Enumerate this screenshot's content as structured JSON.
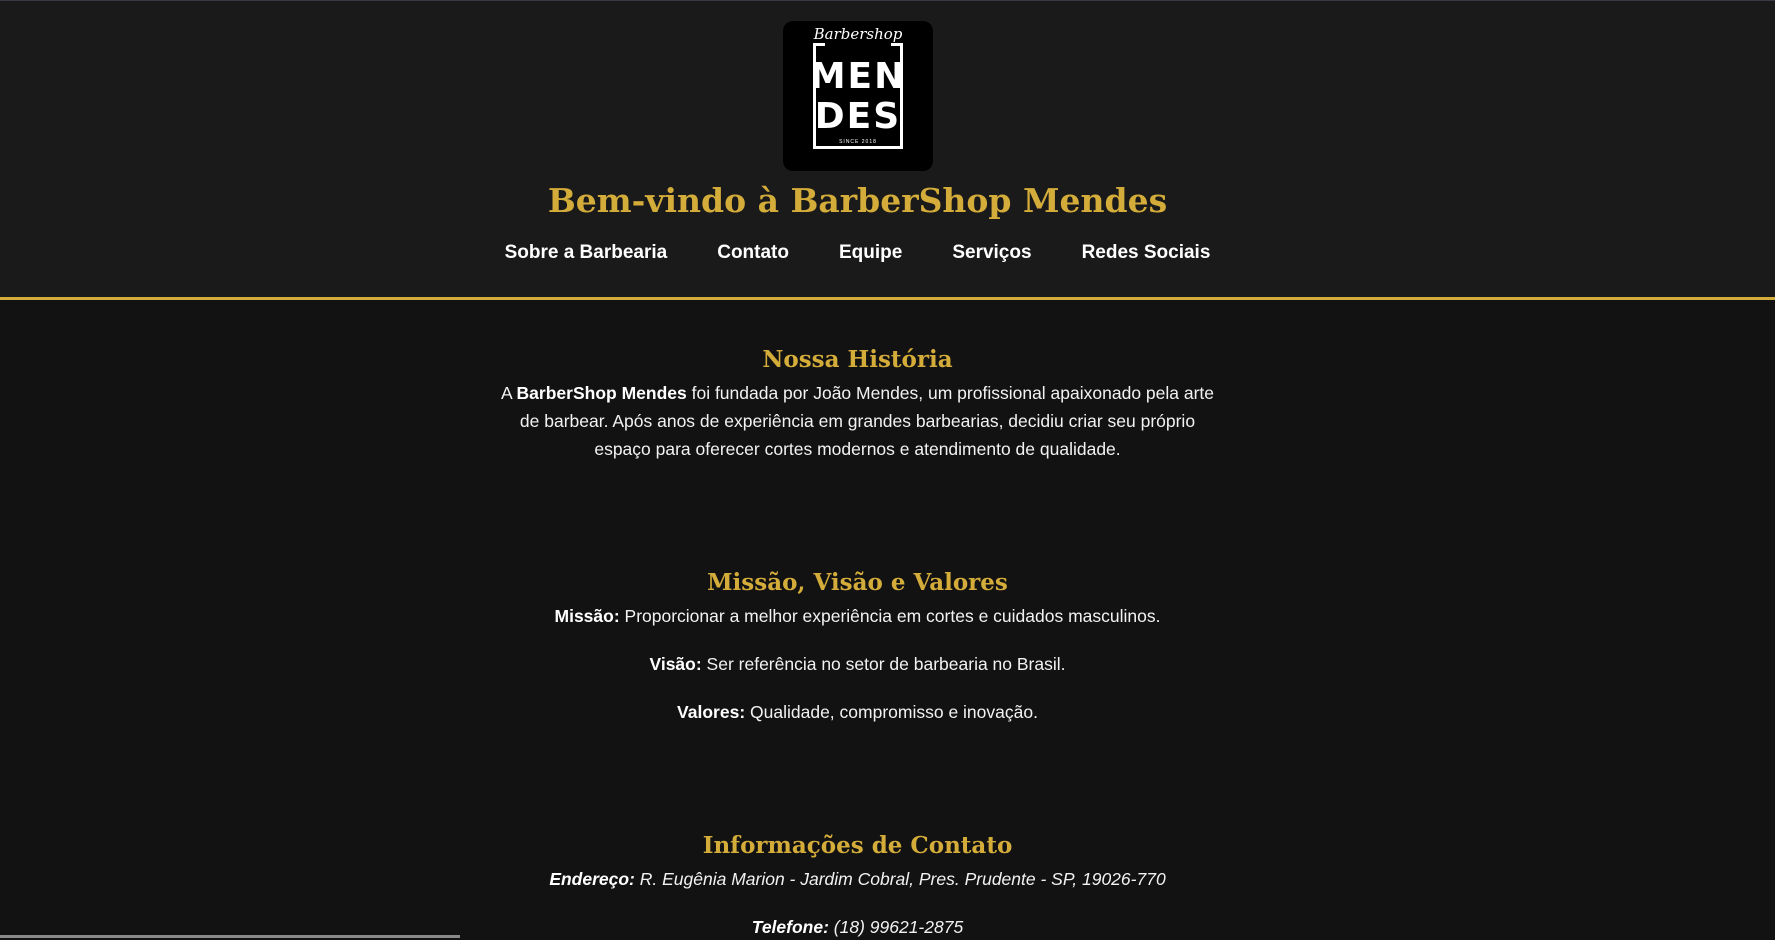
{
  "logo": {
    "script": "Barbershop",
    "line1": "MEN",
    "line2": "DES",
    "since": "SINCE 2018"
  },
  "header": {
    "title": "Bem-vindo à BarberShop Mendes"
  },
  "nav": {
    "items": [
      "Sobre a Barbearia",
      "Contato",
      "Equipe",
      "Serviços",
      "Redes Sociais"
    ]
  },
  "history": {
    "heading": "Nossa História",
    "intro": "A ",
    "brand": "BarberShop Mendes",
    "text": " foi fundada por João Mendes, um profissional apaixonado pela arte de barbear. Após anos de experiência em grandes barbearias, decidiu criar seu próprio espaço para oferecer cortes modernos e atendimento de qualidade."
  },
  "mvv": {
    "heading": "Missão, Visão e Valores",
    "mission_label": "Missão:",
    "mission_text": " Proporcionar a melhor experiência em cortes e cuidados masculinos.",
    "vision_label": "Visão:",
    "vision_text": " Ser referência no setor de barbearia no Brasil.",
    "values_label": "Valores:",
    "values_text": " Qualidade, compromisso e inovação."
  },
  "contact": {
    "heading": "Informações de Contato",
    "address_label": "Endereço:",
    "address_text": " R. Eugênia Marion - Jardim Cobral, Pres. Prudente - SP, 19026-770",
    "phone_label": "Telefone:",
    "phone_text": " (18) 99621-2875"
  },
  "colors": {
    "accent": "#d4ac3a",
    "background": "#121212",
    "header_background": "#1a1a1a"
  }
}
